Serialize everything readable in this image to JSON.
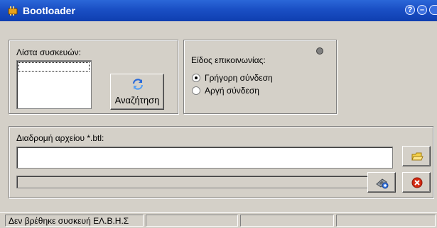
{
  "window": {
    "title": "Bootloader",
    "icons": {
      "app": "chip-icon",
      "help": "help-icon",
      "minimize": "minimize-icon",
      "maximize": "maximize-icon"
    }
  },
  "devices": {
    "label": "Λίστα συσκευών:",
    "items": [],
    "search_button_label": "Αναζήτηση",
    "search_icon": "refresh-icon"
  },
  "communication": {
    "label": "Είδος επικοινωνίας:",
    "options": [
      {
        "label": "Γρήγορη σύνδεση",
        "selected": true
      },
      {
        "label": "Αργή σύνδεση",
        "selected": false
      }
    ],
    "indicator_color": "#808080"
  },
  "file": {
    "label": "Διαδρομή αρχείου *.btl:",
    "path_value": "",
    "browse_icon": "folder-icon",
    "progress_percent": 0,
    "program_icon": "chip-program-icon",
    "cancel_icon": "cancel-icon"
  },
  "status": {
    "message": "Δεν βρέθηκε συσκευή ΕΛ.Β.Η.Σ",
    "panels": [
      "",
      "",
      ""
    ]
  },
  "colors": {
    "titlebar": "#1a4fc4",
    "face": "#d4d0c8",
    "cancel": "#d42a12",
    "search_arrows": "#2a6ad8"
  }
}
